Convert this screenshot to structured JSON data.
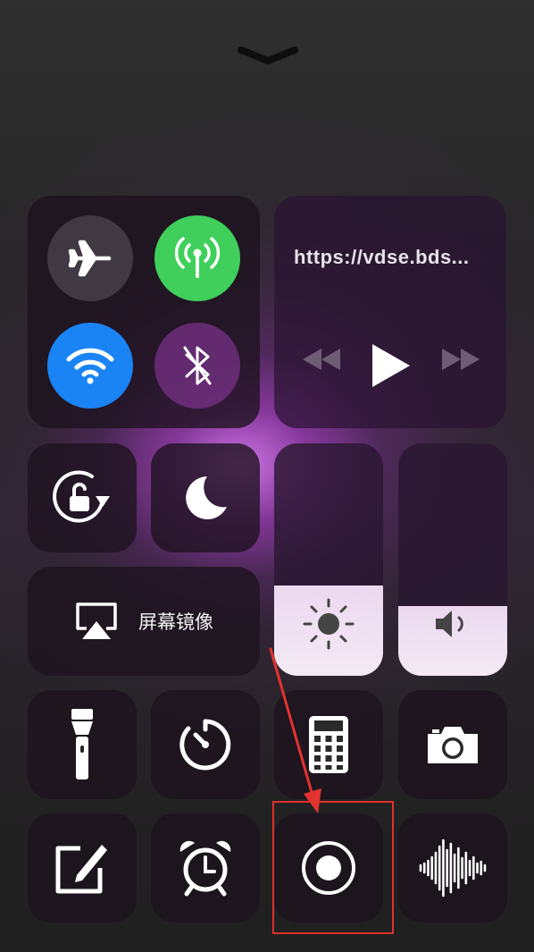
{
  "header": {
    "collapse_icon": "chevron-down-icon"
  },
  "connectivity": {
    "airplane": {
      "icon": "airplane-icon",
      "on": false
    },
    "cellular": {
      "icon": "cellular-antenna-icon",
      "on": true,
      "color": "#3fcf5a"
    },
    "wifi": {
      "icon": "wifi-icon",
      "on": true,
      "color": "#1a84f5"
    },
    "bluetooth": {
      "icon": "bluetooth-off-icon",
      "on": false
    }
  },
  "now_playing": {
    "title": "https://vdse.bds...",
    "controls": [
      "rewind-icon",
      "play-icon",
      "fast-forward-icon"
    ]
  },
  "toggles": {
    "rotation_lock": {
      "icon": "rotation-lock-icon"
    },
    "do_not_disturb": {
      "icon": "moon-icon"
    }
  },
  "screen_mirroring": {
    "label": "屏幕镜像",
    "icon": "airplay-icon"
  },
  "sliders": {
    "brightness": {
      "icon": "sun-icon",
      "level": 0.39
    },
    "volume": {
      "icon": "speaker-icon",
      "level": 0.3
    }
  },
  "shortcuts": [
    {
      "name": "flashlight-icon"
    },
    {
      "name": "timer-icon"
    },
    {
      "name": "calculator-icon"
    },
    {
      "name": "camera-icon"
    },
    {
      "name": "notes-icon"
    },
    {
      "name": "alarm-clock-icon"
    },
    {
      "name": "screen-record-icon"
    },
    {
      "name": "voice-memos-icon"
    }
  ],
  "colors": {
    "highlight": "#e0302c",
    "arrow": "#e33330"
  }
}
